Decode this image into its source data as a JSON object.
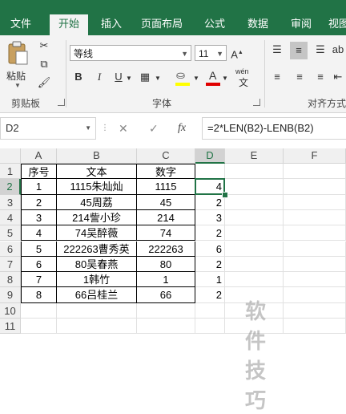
{
  "tabs": [
    "文件",
    "开始",
    "插入",
    "页面布局",
    "公式",
    "数据",
    "审阅",
    "视图"
  ],
  "ribbon": {
    "clipboard": {
      "paste_label": "粘贴",
      "group_label": "剪贴板"
    },
    "font": {
      "font_name": "等线",
      "font_size": "11",
      "bold": "B",
      "italic": "I",
      "underline": "U",
      "font_color_glyph": "A",
      "wen_label": "wén",
      "group_label": "字体"
    },
    "alignment": {
      "group_label": "对齐方式"
    }
  },
  "formula_bar": {
    "cell_ref": "D2",
    "cancel": "✕",
    "enter": "✓",
    "fx": "fx",
    "formula": "=2*LEN(B2)-LENB(B2)"
  },
  "sheet": {
    "columns": [
      "A",
      "B",
      "C",
      "D",
      "E",
      "F"
    ],
    "row_numbers": [
      "1",
      "2",
      "3",
      "4",
      "5",
      "6",
      "7",
      "8",
      "9",
      "10",
      "11"
    ],
    "selected_cell": "D2",
    "header_row": [
      "序号",
      "文本",
      "数字"
    ],
    "rows": [
      {
        "a": "1",
        "b": "1115朱灿灿",
        "c": "1115",
        "d": "4"
      },
      {
        "a": "2",
        "b": "45周荔",
        "c": "45",
        "d": "2"
      },
      {
        "a": "3",
        "b": "214訾小珍",
        "c": "214",
        "d": "3"
      },
      {
        "a": "4",
        "b": "74吴醉薇",
        "c": "74",
        "d": "2"
      },
      {
        "a": "5",
        "b": "222263曹秀英",
        "c": "222263",
        "d": "6"
      },
      {
        "a": "6",
        "b": "80吴春燕",
        "c": "80",
        "d": "2"
      },
      {
        "a": "7",
        "b": "1韩竹",
        "c": "1",
        "d": "1"
      },
      {
        "a": "8",
        "b": "66吕桂兰",
        "c": "66",
        "d": "2"
      }
    ]
  },
  "watermark": "软件技巧",
  "colors": {
    "accent": "#217346",
    "ribbon_bg": "#f3f3f3",
    "gridline": "#e1e1e1"
  }
}
